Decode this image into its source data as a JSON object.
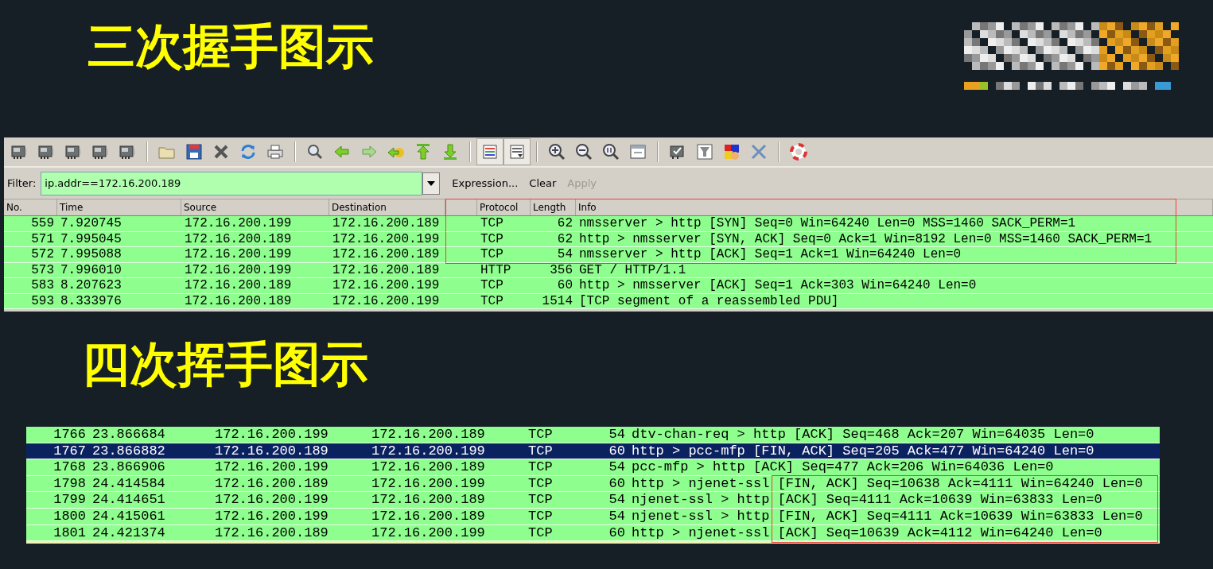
{
  "sections": [
    {
      "title": "三次握手图示",
      "capture": {
        "kind": "full",
        "toolbar": [
          [
            {
              "kind": "nic",
              "pressed": false
            },
            {
              "kind": "nic",
              "pressed": false
            },
            {
              "kind": "nic",
              "pressed": false
            },
            {
              "kind": "nic",
              "pressed": false
            },
            {
              "kind": "nic",
              "pressed": false
            }
          ],
          [
            {
              "kind": "open",
              "pressed": false
            },
            {
              "kind": "save",
              "pressed": false
            },
            {
              "kind": "close",
              "pressed": false
            },
            {
              "kind": "reload",
              "pressed": false
            },
            {
              "kind": "print",
              "pressed": false
            }
          ],
          [
            {
              "kind": "find",
              "pressed": false
            },
            {
              "kind": "back",
              "pressed": false
            },
            {
              "kind": "forward",
              "pressed": false
            },
            {
              "kind": "goto",
              "pressed": false
            },
            {
              "kind": "first",
              "pressed": false
            },
            {
              "kind": "last",
              "pressed": false
            }
          ],
          [
            {
              "kind": "colorize",
              "pressed": true
            },
            {
              "kind": "autoscroll",
              "pressed": true
            }
          ],
          [
            {
              "kind": "zoomin",
              "pressed": false
            },
            {
              "kind": "zoomout",
              "pressed": false
            },
            {
              "kind": "zoomnormal",
              "pressed": false
            },
            {
              "kind": "resize",
              "pressed": false
            }
          ],
          [
            {
              "kind": "capfilter",
              "pressed": false
            },
            {
              "kind": "dispfilter",
              "pressed": false
            },
            {
              "kind": "coloring",
              "pressed": false
            },
            {
              "kind": "prefs",
              "pressed": false
            }
          ],
          [
            {
              "kind": "help",
              "pressed": false
            }
          ]
        ],
        "filter": {
          "label": "Filter:",
          "value": "ip.addr==172.16.200.189",
          "actions": [
            {
              "label": "Expression...",
              "disabled": false
            },
            {
              "label": "Clear",
              "disabled": false
            },
            {
              "label": "Apply",
              "disabled": true
            }
          ]
        },
        "columns": [
          "No.",
          "Time",
          "Source",
          "Destination",
          "Protocol",
          "Length",
          "Info"
        ],
        "header_highlighted": true,
        "rows": [
          {
            "no": "559",
            "time": "7.920745",
            "source": "172.16.200.199",
            "destination": "172.16.200.189",
            "protocol": "TCP",
            "length": "62",
            "info": "nmsserver > http [SYN] Seq=0 Win=64240 Len=0 MSS=1460 SACK_PERM=1",
            "selected": false,
            "highlighted": true
          },
          {
            "no": "571",
            "time": "7.995045",
            "source": "172.16.200.189",
            "destination": "172.16.200.199",
            "protocol": "TCP",
            "length": "62",
            "info": "http > nmsserver [SYN, ACK] Seq=0 Ack=1 Win=8192 Len=0 MSS=1460 SACK_PERM=1",
            "selected": false,
            "highlighted": true
          },
          {
            "no": "572",
            "time": "7.995088",
            "source": "172.16.200.199",
            "destination": "172.16.200.189",
            "protocol": "TCP",
            "length": "54",
            "info": "nmsserver > http [ACK] Seq=1 Ack=1 Win=64240 Len=0",
            "selected": false,
            "highlighted": true
          },
          {
            "no": "573",
            "time": "7.996010",
            "source": "172.16.200.199",
            "destination": "172.16.200.189",
            "protocol": "HTTP",
            "length": "356",
            "info": "GET / HTTP/1.1",
            "selected": false,
            "highlighted": false
          },
          {
            "no": "583",
            "time": "8.207623",
            "source": "172.16.200.189",
            "destination": "172.16.200.199",
            "protocol": "TCP",
            "length": "60",
            "info": "http > nmsserver [ACK] Seq=1 Ack=303 Win=64240 Len=0",
            "selected": false,
            "highlighted": false
          },
          {
            "no": "593",
            "time": "8.333976",
            "source": "172.16.200.189",
            "destination": "172.16.200.199",
            "protocol": "TCP",
            "length": "1514",
            "info": "[TCP segment of a reassembled PDU]",
            "selected": false,
            "highlighted": false
          }
        ]
      }
    },
    {
      "title": "四次挥手图示",
      "capture": {
        "kind": "rows",
        "rows": [
          {
            "no": "1766",
            "time": "23.866684",
            "source": "172.16.200.199",
            "destination": "172.16.200.189",
            "protocol": "TCP",
            "length": "54",
            "info": "dtv-chan-req > http [ACK] Seq=468 Ack=207 Win=64035 Len=0",
            "selected": false,
            "highlighted": false
          },
          {
            "no": "1767",
            "time": "23.866882",
            "source": "172.16.200.189",
            "destination": "172.16.200.199",
            "protocol": "TCP",
            "length": "60",
            "info": "http > pcc-mfp [FIN, ACK] Seq=205 Ack=477 Win=64240 Len=0",
            "selected": true,
            "highlighted": false
          },
          {
            "no": "1768",
            "time": "23.866906",
            "source": "172.16.200.199",
            "destination": "172.16.200.189",
            "protocol": "TCP",
            "length": "54",
            "info": "pcc-mfp > http [ACK] Seq=477 Ack=206 Win=64036 Len=0",
            "selected": false,
            "highlighted": false
          },
          {
            "no": "1798",
            "time": "24.414584",
            "source": "172.16.200.189",
            "destination": "172.16.200.199",
            "protocol": "TCP",
            "length": "60",
            "info": "http > njenet-ssl [FIN, ACK] Seq=10638 Ack=4111 Win=64240 Len=0",
            "selected": false,
            "highlighted": true
          },
          {
            "no": "1799",
            "time": "24.414651",
            "source": "172.16.200.199",
            "destination": "172.16.200.189",
            "protocol": "TCP",
            "length": "54",
            "info": "njenet-ssl > http [ACK] Seq=4111 Ack=10639 Win=63833 Len=0",
            "selected": false,
            "highlighted": true
          },
          {
            "no": "1800",
            "time": "24.415061",
            "source": "172.16.200.199",
            "destination": "172.16.200.189",
            "protocol": "TCP",
            "length": "54",
            "info": "njenet-ssl > http [FIN, ACK] Seq=4111 Ack=10639 Win=63833 Len=0",
            "selected": false,
            "highlighted": true
          },
          {
            "no": "1801",
            "time": "24.421374",
            "source": "172.16.200.189",
            "destination": "172.16.200.199",
            "protocol": "TCP",
            "length": "60",
            "info": "http > njenet-ssl [ACK] Seq=10639 Ack=4112 Win=64240 Len=0",
            "selected": false,
            "highlighted": true
          }
        ]
      }
    }
  ]
}
